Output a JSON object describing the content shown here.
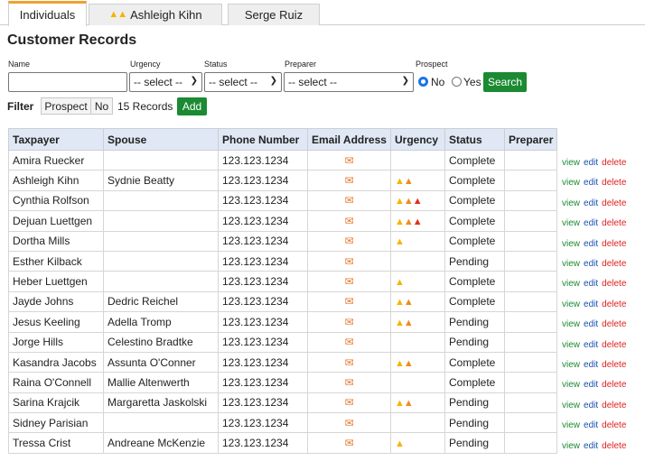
{
  "tabs": [
    {
      "label": "Individuals",
      "flames": ""
    },
    {
      "label": "Ashleigh Kihn",
      "flames": "🔥🔥"
    },
    {
      "label": "Serge Ruiz",
      "flames": ""
    }
  ],
  "title": "Customer Records",
  "search_form": {
    "name_label": "Name",
    "name_value": "",
    "urgency_label": "Urgency",
    "urgency_selected": "-- select --",
    "status_label": "Status",
    "status_selected": "-- select --",
    "preparer_label": "Preparer",
    "preparer_selected": "-- select --",
    "prospect_label": "Prospect",
    "prospect_no": "No",
    "prospect_yes": "Yes",
    "prospect_selected": "No",
    "search_button": "Search"
  },
  "filter": {
    "label": "Filter",
    "prospect_button": "Prospect",
    "no_button": "No",
    "count": "15 Records",
    "add_button": "Add"
  },
  "table": {
    "headers": [
      "Taxpayer",
      "Spouse",
      "Phone Number",
      "Email Address",
      "Urgency",
      "Status",
      "Preparer"
    ],
    "rows": [
      {
        "taxpayer": "Amira Ruecker",
        "spouse": "",
        "phone": "123.123.1234",
        "urgency": 0,
        "status": "Complete",
        "preparer": ""
      },
      {
        "taxpayer": "Ashleigh Kihn",
        "spouse": "Sydnie Beatty",
        "phone": "123.123.1234",
        "urgency": 2,
        "status": "Complete",
        "preparer": ""
      },
      {
        "taxpayer": "Cynthia Rolfson",
        "spouse": "",
        "phone": "123.123.1234",
        "urgency": 3,
        "status": "Complete",
        "preparer": ""
      },
      {
        "taxpayer": "Dejuan Luettgen",
        "spouse": "",
        "phone": "123.123.1234",
        "urgency": 3,
        "status": "Complete",
        "preparer": ""
      },
      {
        "taxpayer": "Dortha Mills",
        "spouse": "",
        "phone": "123.123.1234",
        "urgency": 1,
        "status": "Complete",
        "preparer": ""
      },
      {
        "taxpayer": "Esther Kilback",
        "spouse": "",
        "phone": "123.123.1234",
        "urgency": 0,
        "status": "Pending",
        "preparer": ""
      },
      {
        "taxpayer": "Heber Luettgen",
        "spouse": "",
        "phone": "123.123.1234",
        "urgency": 1,
        "status": "Complete",
        "preparer": ""
      },
      {
        "taxpayer": "Jayde Johns",
        "spouse": "Dedric Reichel",
        "phone": "123.123.1234",
        "urgency": 2,
        "status": "Complete",
        "preparer": ""
      },
      {
        "taxpayer": "Jesus Keeling",
        "spouse": "Adella Tromp",
        "phone": "123.123.1234",
        "urgency": 2,
        "status": "Pending",
        "preparer": ""
      },
      {
        "taxpayer": "Jorge Hills",
        "spouse": "Celestino Bradtke",
        "phone": "123.123.1234",
        "urgency": 0,
        "status": "Pending",
        "preparer": ""
      },
      {
        "taxpayer": "Kasandra Jacobs",
        "spouse": "Assunta O'Conner",
        "phone": "123.123.1234",
        "urgency": 2,
        "status": "Complete",
        "preparer": ""
      },
      {
        "taxpayer": "Raina O'Connell",
        "spouse": "Mallie Altenwerth",
        "phone": "123.123.1234",
        "urgency": 0,
        "status": "Complete",
        "preparer": ""
      },
      {
        "taxpayer": "Sarina Krajcik",
        "spouse": "Margaretta Jaskolski",
        "phone": "123.123.1234",
        "urgency": 2,
        "status": "Pending",
        "preparer": ""
      },
      {
        "taxpayer": "Sidney Parisian",
        "spouse": "",
        "phone": "123.123.1234",
        "urgency": 0,
        "status": "Pending",
        "preparer": ""
      },
      {
        "taxpayer": "Tressa Crist",
        "spouse": "Andreane McKenzie",
        "phone": "123.123.1234",
        "urgency": 1,
        "status": "Pending",
        "preparer": ""
      }
    ]
  },
  "row_actions": {
    "view": "view",
    "edit": "edit",
    "delete": "delete"
  },
  "icons": {
    "email": "envelope-icon",
    "urgency": "flame-icon"
  },
  "colors": {
    "accent_tab": "#f0a030",
    "button_green": "#1b8a32",
    "header_bg": "#dfe8f4",
    "email_icon": "#e8772e"
  }
}
